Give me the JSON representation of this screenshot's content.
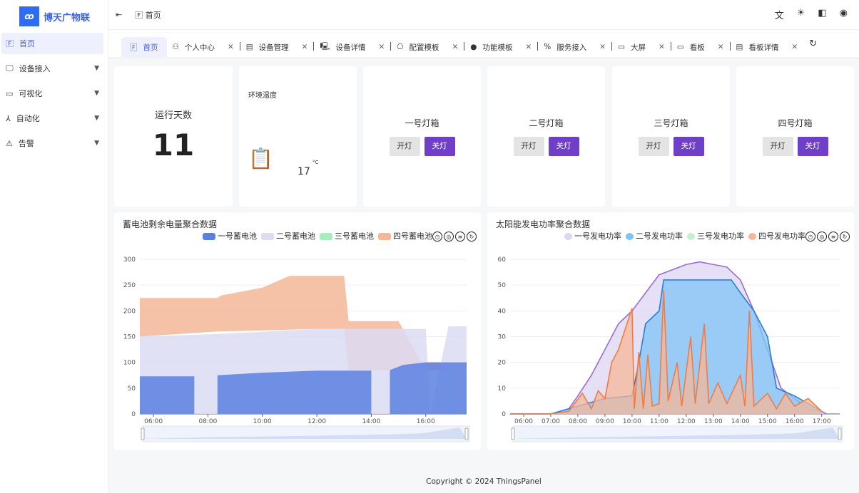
{
  "brand": {
    "name": "博天广物联"
  },
  "sidebar": {
    "items": [
      {
        "label": "首页",
        "icon": "home-icon",
        "active": true
      },
      {
        "label": "设备接入",
        "icon": "monitor-icon"
      },
      {
        "label": "可视化",
        "icon": "screen-icon"
      },
      {
        "label": "自动化",
        "icon": "flow-icon"
      },
      {
        "label": "告警",
        "icon": "warning-icon"
      }
    ]
  },
  "header": {
    "breadcrumb": "首页"
  },
  "tabs": [
    {
      "label": "首页",
      "active": true
    },
    {
      "label": "个人中心"
    },
    {
      "label": "设备管理"
    },
    {
      "label": "设备详情"
    },
    {
      "label": "配置模板"
    },
    {
      "label": "功能模板"
    },
    {
      "label": "服务接入"
    },
    {
      "label": "大屏"
    },
    {
      "label": "看板"
    },
    {
      "label": "看板详情"
    }
  ],
  "cards": {
    "uptime": {
      "label": "运行天数",
      "value": "11"
    },
    "temp": {
      "label": "环境温度",
      "value": "17",
      "unit": "°C"
    },
    "lamps": [
      {
        "name": "一号灯箱"
      },
      {
        "name": "二号灯箱"
      },
      {
        "name": "三号灯箱"
      },
      {
        "name": "四号灯箱"
      }
    ],
    "on_label": "开灯",
    "off_label": "关灯"
  },
  "colors": {
    "accent": "#6f3fc9",
    "s1": "#5b80e0",
    "s2": "#dcdcf3",
    "s3": "#a8ecbf",
    "s4": "#f5b798"
  },
  "chart_data": [
    {
      "type": "bar",
      "title": "蓄电池剩余电量聚合数据",
      "ylim": [
        0,
        300
      ],
      "yticks": [
        0,
        50,
        100,
        150,
        200,
        250,
        300
      ],
      "xticks": [
        "06:00",
        "08:00",
        "10:00",
        "12:00",
        "14:00",
        "16:00"
      ],
      "xrange": [
        "05:30",
        "17:30"
      ],
      "series": [
        {
          "name": "四号蓄电池",
          "color": "#f5b798",
          "points": [
            [
              "05:30",
              225
            ],
            [
              "07:00",
              225
            ],
            [
              "07:20",
              225
            ],
            [
              "08:20",
              225
            ],
            [
              "08:30",
              230
            ],
            [
              "10:00",
              245
            ],
            [
              "11:00",
              268
            ],
            [
              "13:00",
              268
            ],
            [
              "13:10",
              180
            ],
            [
              "14:00",
              180
            ],
            [
              "15:00",
              180
            ],
            [
              "15:50",
              100
            ],
            [
              "17:30",
              100
            ]
          ],
          "base": [
            [
              "05:30",
              150
            ],
            [
              "08:20",
              160
            ],
            [
              "10:00",
              162
            ],
            [
              "12:00",
              165
            ],
            [
              "13:00",
              165
            ],
            [
              "13:10",
              85
            ],
            [
              "17:30",
              85
            ]
          ]
        },
        {
          "name": "二号蓄电池",
          "color": "#dcdcf3",
          "points": [
            [
              "05:30",
              150
            ],
            [
              "08:20",
              155
            ],
            [
              "12:00",
              165
            ],
            [
              "13:00",
              165
            ],
            [
              "14:00",
              165
            ],
            [
              "16:00",
              165
            ],
            [
              "16:10",
              0
            ],
            [
              "16:50",
              170
            ],
            [
              "17:30",
              170
            ]
          ],
          "base": [
            [
              "05:30",
              0
            ],
            [
              "17:30",
              0
            ]
          ]
        },
        {
          "name": "三号蓄电池",
          "color": "#a8ecbf",
          "points": [],
          "base": []
        },
        {
          "name": "一号蓄电池",
          "color": "#5b80e0",
          "points": [
            [
              "05:30",
              73
            ],
            [
              "07:30",
              73
            ],
            [
              "07:31",
              null
            ],
            [
              "08:20",
              null
            ],
            [
              "08:21",
              75
            ],
            [
              "10:00",
              80
            ],
            [
              "12:00",
              84
            ],
            [
              "14:00",
              84
            ],
            [
              "14:01",
              null
            ],
            [
              "14:40",
              null
            ],
            [
              "14:41",
              85
            ],
            [
              "15:10",
              95
            ],
            [
              "16:00",
              100
            ],
            [
              "17:30",
              100
            ]
          ],
          "base": []
        }
      ]
    },
    {
      "type": "line",
      "title": "太阳能发电功率聚合数据",
      "ylim": [
        0,
        60
      ],
      "yticks": [
        0,
        10,
        20,
        30,
        40,
        50,
        60
      ],
      "xticks": [
        "06:00",
        "07:00",
        "08:00",
        "09:00",
        "10:00",
        "11:00",
        "12:00",
        "13:00",
        "14:00",
        "15:00",
        "16:00",
        "17:00"
      ],
      "xrange": [
        "05:30",
        "17:40"
      ],
      "series": [
        {
          "name": "一号发电功率",
          "color": "#9a6bd8",
          "fill": "#dcd6f3",
          "points": [
            [
              "05:30",
              0
            ],
            [
              "07:00",
              0
            ],
            [
              "07:40",
              2
            ],
            [
              "08:00",
              7
            ],
            [
              "08:30",
              15
            ],
            [
              "09:00",
              25
            ],
            [
              "09:30",
              35
            ],
            [
              "10:00",
              40
            ],
            [
              "10:30",
              47
            ],
            [
              "11:00",
              54
            ],
            [
              "11:30",
              56
            ],
            [
              "12:00",
              58
            ],
            [
              "12:30",
              59
            ],
            [
              "13:00",
              58
            ],
            [
              "13:30",
              57
            ],
            [
              "14:00",
              52
            ],
            [
              "14:30",
              40
            ],
            [
              "15:00",
              25
            ],
            [
              "15:30",
              10
            ],
            [
              "16:00",
              6
            ],
            [
              "16:30",
              2
            ],
            [
              "17:00",
              1
            ],
            [
              "17:10",
              0
            ]
          ]
        },
        {
          "name": "二号发电功率",
          "color": "#2a7ed8",
          "fill": "#7fc4f5",
          "points": [
            [
              "05:30",
              0
            ],
            [
              "07:00",
              0
            ],
            [
              "08:00",
              3
            ],
            [
              "09:00",
              6
            ],
            [
              "10:00",
              7
            ],
            [
              "10:15",
              20
            ],
            [
              "10:30",
              35
            ],
            [
              "11:00",
              40
            ],
            [
              "11:10",
              52
            ],
            [
              "13:40",
              52
            ],
            [
              "14:00",
              47
            ],
            [
              "14:30",
              40
            ],
            [
              "15:00",
              30
            ],
            [
              "15:20",
              10
            ],
            [
              "16:00",
              7
            ],
            [
              "17:00",
              1
            ]
          ]
        },
        {
          "name": "三号发电功率",
          "color": "#8ee4a9",
          "fill": "#c2f0d0",
          "points": []
        },
        {
          "name": "四号发电功率",
          "color": "#f07c45",
          "fill": "#f5b798",
          "points": [
            [
              "05:30",
              0
            ],
            [
              "07:00",
              0
            ],
            [
              "07:40",
              1
            ],
            [
              "08:10",
              8
            ],
            [
              "08:30",
              2
            ],
            [
              "08:45",
              9
            ],
            [
              "09:00",
              6
            ],
            [
              "09:15",
              20
            ],
            [
              "09:30",
              25
            ],
            [
              "09:45",
              33
            ],
            [
              "10:00",
              41
            ],
            [
              "10:05",
              2
            ],
            [
              "10:15",
              24
            ],
            [
              "10:25",
              2
            ],
            [
              "10:35",
              23
            ],
            [
              "10:45",
              3
            ],
            [
              "11:00",
              4
            ],
            [
              "11:10",
              48
            ],
            [
              "11:20",
              5
            ],
            [
              "11:40",
              20
            ],
            [
              "11:50",
              3
            ],
            [
              "12:10",
              30
            ],
            [
              "12:20",
              4
            ],
            [
              "12:40",
              35
            ],
            [
              "12:50",
              4
            ],
            [
              "13:10",
              12
            ],
            [
              "13:30",
              4
            ],
            [
              "14:00",
              15
            ],
            [
              "14:10",
              3
            ],
            [
              "14:20",
              40
            ],
            [
              "14:30",
              3
            ],
            [
              "15:00",
              8
            ],
            [
              "15:20",
              2
            ],
            [
              "15:40",
              8
            ],
            [
              "16:00",
              3
            ],
            [
              "16:30",
              6
            ],
            [
              "17:00",
              1
            ]
          ]
        }
      ]
    }
  ],
  "footer": "Copyright © 2024 ThingsPanel"
}
